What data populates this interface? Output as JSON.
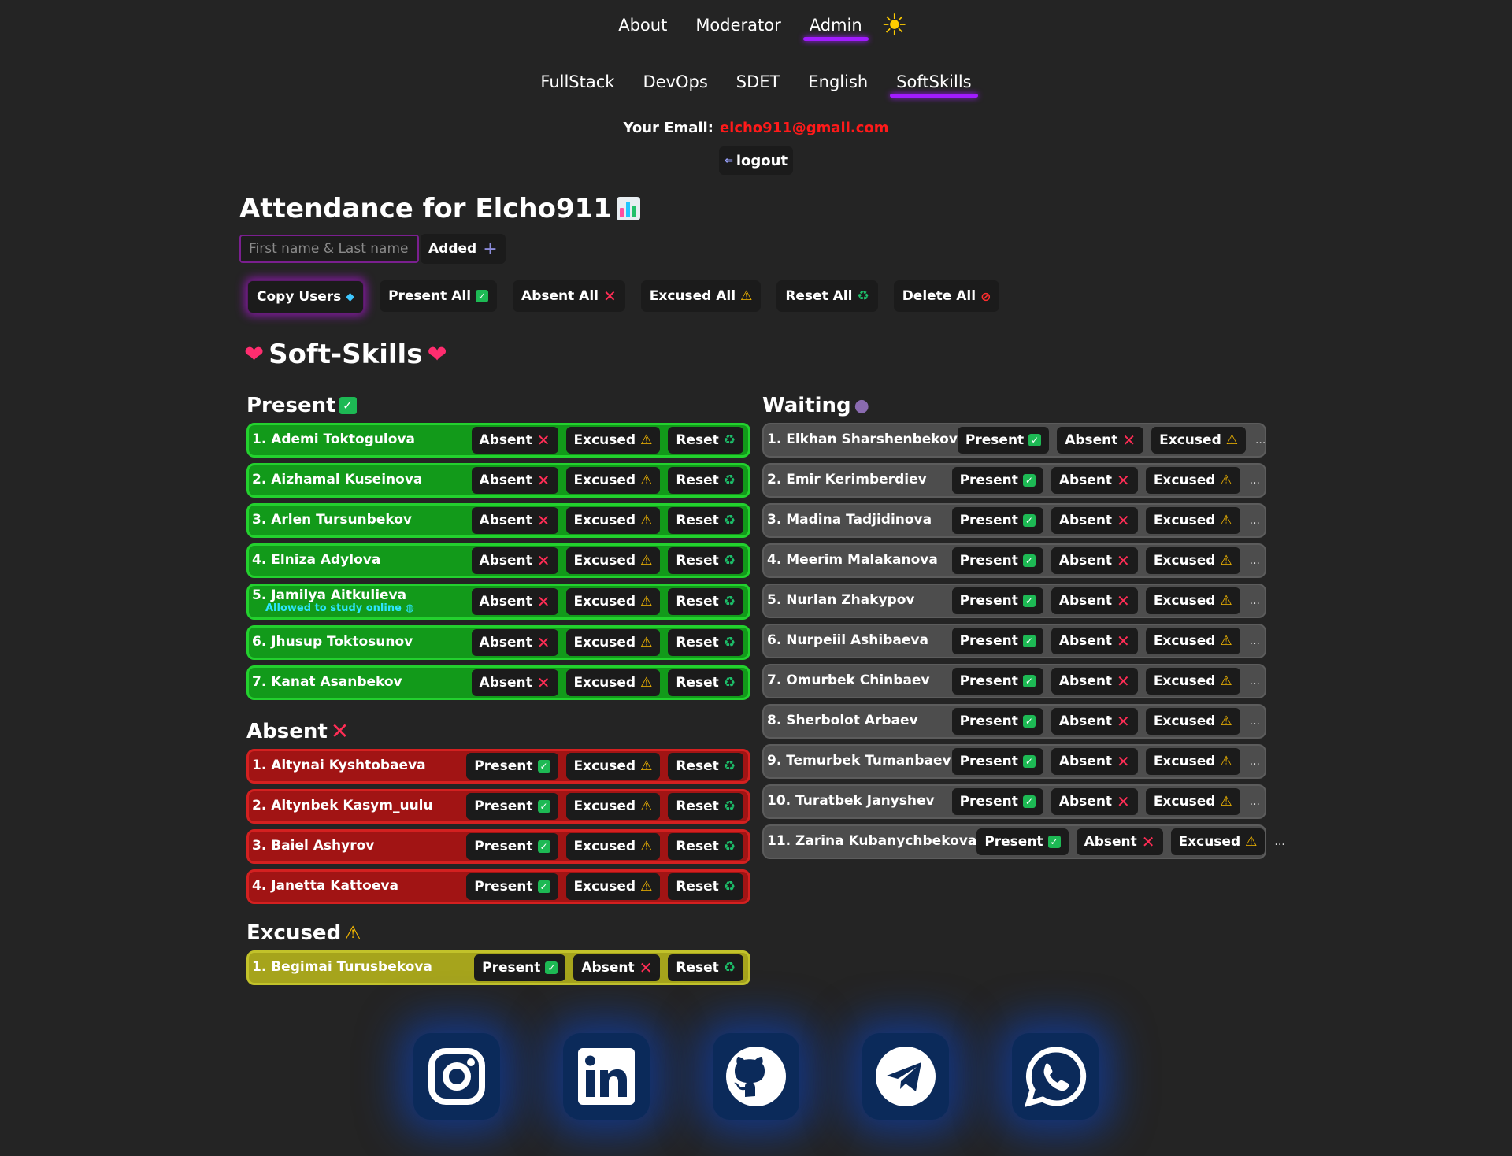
{
  "nav": {
    "top": [
      "About",
      "Moderator",
      "Admin"
    ],
    "active_top": "Admin",
    "tracks": [
      "FullStack",
      "DevOps",
      "SDET",
      "English",
      "SoftSkills"
    ],
    "active_track": "SoftSkills"
  },
  "email_label": "Your Email:",
  "email": "elcho911@gmail.com",
  "logout_label": "logout",
  "title": "Attendance for Elcho911",
  "input_placeholder": "First name & Last name",
  "added_label": "Added",
  "bulk": [
    "Copy Users",
    "Present All",
    "Absent All",
    "Excused All",
    "Reset All",
    "Delete All"
  ],
  "section_title": "Soft-Skills",
  "groups": {
    "present": {
      "title": "Present",
      "actions": [
        "Absent",
        "Excused",
        "Reset"
      ],
      "items": [
        {
          "name": "1. Ademi Toktogulova"
        },
        {
          "name": "2. Aizhamal Kuseinova"
        },
        {
          "name": "3. Arlen Tursunbekov"
        },
        {
          "name": "4. Elniza Adylova"
        },
        {
          "name": "5. Jamilya Aitkulieva",
          "note": "Allowed to study online"
        },
        {
          "name": "6. Jhusup Toktosunov"
        },
        {
          "name": "7. Kanat Asanbekov"
        }
      ]
    },
    "absent": {
      "title": "Absent",
      "actions": [
        "Present",
        "Excused",
        "Reset"
      ],
      "items": [
        {
          "name": "1. Altynai Kyshtobaeva"
        },
        {
          "name": "2. Altynbek Kasym_uulu"
        },
        {
          "name": "3. Baiel Ashyrov"
        },
        {
          "name": "4. Janetta Kattoeva"
        }
      ]
    },
    "excused": {
      "title": "Excused",
      "actions": [
        "Present",
        "Absent",
        "Reset"
      ],
      "items": [
        {
          "name": "1. Begimai Turusbekova"
        }
      ]
    },
    "waiting": {
      "title": "Waiting",
      "actions": [
        "Present",
        "Absent",
        "Excused"
      ],
      "items": [
        {
          "name": "1. Elkhan Sharshenbekov"
        },
        {
          "name": "2. Emir Kerimberdiev"
        },
        {
          "name": "3. Madina Tadjidinova"
        },
        {
          "name": "4. Meerim Malakanova"
        },
        {
          "name": "5. Nurlan Zhakypov"
        },
        {
          "name": "6. Nurpeiil Ashibaeva"
        },
        {
          "name": "7. Omurbek Chinbaev"
        },
        {
          "name": "8. Sherbolot Arbaev"
        },
        {
          "name": "9. Temurbek Tumanbaev"
        },
        {
          "name": "10. Turatbek Janyshev"
        },
        {
          "name": "11. Zarina Kubanychbekova"
        }
      ]
    }
  },
  "social": [
    "instagram-icon",
    "linkedin-icon",
    "github-icon",
    "telegram-icon",
    "whatsapp-icon"
  ],
  "colors": {
    "present_bg": "#129a1a",
    "absent_bg": "#a11414",
    "excused_bg": "#a6a41c",
    "waiting_bg": "#4d4d4d",
    "accent": "#a11cff",
    "email": "#ff1a1a"
  }
}
